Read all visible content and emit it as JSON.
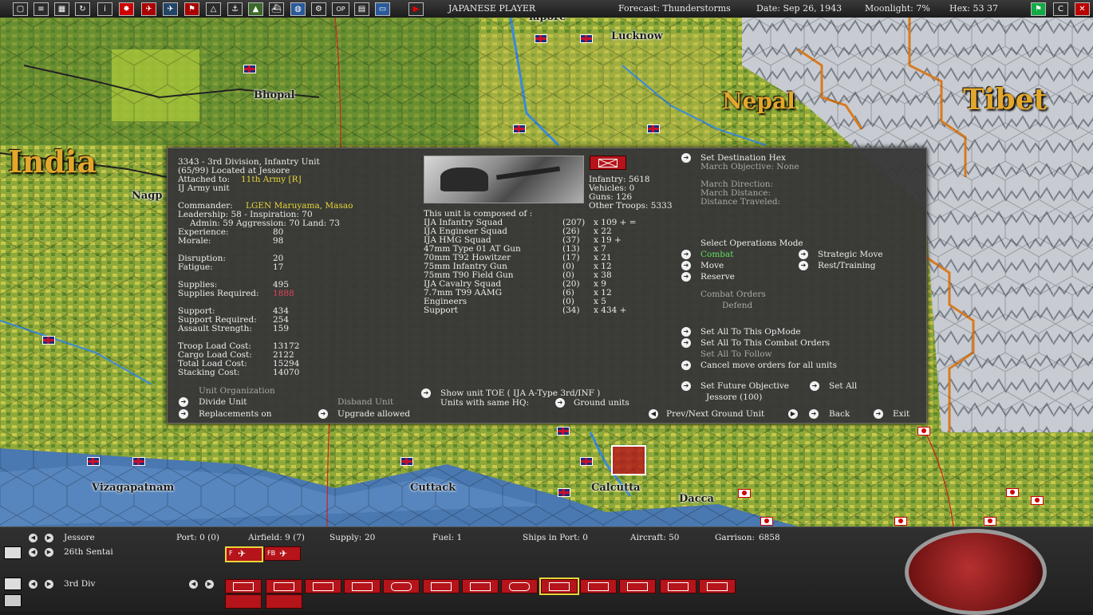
{
  "topbar": {
    "player": "JAPANESE PLAYER",
    "forecast": "Forecast: Thunderstorms",
    "date": "Date: Sep 26, 1943",
    "moonlight": "Moonlight: 7%",
    "hex": "Hex: 53 37",
    "buttons": [
      "OP"
    ]
  },
  "map": {
    "cities": [
      "Lucknow",
      "Bhopal",
      "Nagp",
      "Vizagapatnam",
      "Cuttack",
      "Calcutta",
      "Dacca"
    ],
    "regions": [
      "India",
      "Nepal",
      "Tibet"
    ],
    "partial_label": "lapore"
  },
  "unit": {
    "title": "3343 - 3rd Division, Infantry Unit",
    "location": "(65/99) Located at Jessore",
    "attached_label": "Attached to:",
    "attached_value": "11th Army [R]",
    "type": "IJ Army unit",
    "commander_label": "Commander:",
    "commander_value": "LGEN Maruyama, Masao",
    "leadership": "Leadership: 58 - Inspiration: 70",
    "admin": "Admin: 59  Aggression: 70  Land: 73",
    "stats": [
      {
        "label": "Experience:",
        "value": "80"
      },
      {
        "label": "Morale:",
        "value": "98"
      },
      {
        "label": "Disruption:",
        "value": "20"
      },
      {
        "label": "Fatigue:",
        "value": "17"
      },
      {
        "label": "Supplies:",
        "value": "495"
      },
      {
        "label": "Supplies Required:",
        "value": "1888"
      },
      {
        "label": "Support:",
        "value": "434"
      },
      {
        "label": "Support Required:",
        "value": "254"
      },
      {
        "label": "Assault Strength:",
        "value": "159"
      },
      {
        "label": "Troop Load Cost:",
        "value": "13172"
      },
      {
        "label": "Cargo Load Cost:",
        "value": "2122"
      },
      {
        "label": "Total Load Cost:",
        "value": "15294"
      },
      {
        "label": "Stacking Cost:",
        "value": "14070"
      }
    ],
    "org": {
      "header": "Unit Organization",
      "divide": "Divide Unit",
      "disband": "Disband Unit",
      "replacements": "Replacements on",
      "upgrade": "Upgrade allowed"
    },
    "totals": {
      "infantry": "Infantry: 5618",
      "vehicles": "Vehicles: 0",
      "guns": "Guns: 126",
      "other": "Other Troops: 5333"
    },
    "composed_header": "This unit is composed of :",
    "composition": [
      {
        "name": "IJA Infantry Squad",
        "count": "(207)",
        "mult": "x 109 + ="
      },
      {
        "name": "IJA Engineer Squad",
        "count": "(26)",
        "mult": "x 22"
      },
      {
        "name": "IJA HMG Squad",
        "count": "(37)",
        "mult": "x 19 +"
      },
      {
        "name": "47mm Type 01 AT Gun",
        "count": "(13)",
        "mult": "x 7"
      },
      {
        "name": "70mm T92 Howitzer",
        "count": "(17)",
        "mult": "x 21"
      },
      {
        "name": "75mm Infantry Gun",
        "count": "(0)",
        "mult": "x 12"
      },
      {
        "name": "75mm T90 Field Gun",
        "count": "(0)",
        "mult": "x 38"
      },
      {
        "name": "IJA Cavalry Squad",
        "count": "(20)",
        "mult": "x 9"
      },
      {
        "name": "7.7mm T99 AAMG",
        "count": "(6)",
        "mult": "x 12"
      },
      {
        "name": "Engineers",
        "count": "(0)",
        "mult": "x 5"
      },
      {
        "name": "Support",
        "count": "(34)",
        "mult": "x 434 +"
      }
    ],
    "toe": "Show unit TOE ( IJA A-Type 3rd/INF )",
    "same_hq": "Units with same HQ:",
    "ground_units": "Ground units"
  },
  "orders": {
    "set_dest": "Set Destination Hex",
    "march_obj": "March Objective: None",
    "march_dir": "March Direction:",
    "march_dist": "March Distance:",
    "dist_traveled": "Distance Traveled:",
    "select_ops": "Select Operations Mode",
    "combat": "Combat",
    "strategic": "Strategic Move",
    "move": "Move",
    "rest": "Rest/Training",
    "reserve": "Reserve",
    "combat_orders": "Combat Orders",
    "defend": "Defend",
    "set_all_opmode": "Set All To This OpMode",
    "set_all_combat": "Set All To This Combat Orders",
    "set_all_follow": "Set All To Follow",
    "cancel_move": "Cancel move orders for all units",
    "future_obj": "Set Future Objective",
    "set_all": "Set All",
    "jessore": "Jessore (100)",
    "prevnext": "Prev/Next Ground Unit",
    "back": "Back",
    "exit": "Exit"
  },
  "bottom": {
    "base": "Jessore",
    "port": "Port: 0 (0)",
    "airfield": "Airfield: 9 (7)",
    "supply_label": "Supply:",
    "supply_value": "20",
    "fuel": "Fuel: 1",
    "ships": "Ships in Port: 0",
    "aircraft": "Aircraft: 50",
    "garrison_label": "Garrison:",
    "garrison_value": "6858",
    "air_unit": "26th Sentai",
    "air_chip_f": "F",
    "air_chip_fb": "FB",
    "ground_unit": "3rd Div"
  }
}
